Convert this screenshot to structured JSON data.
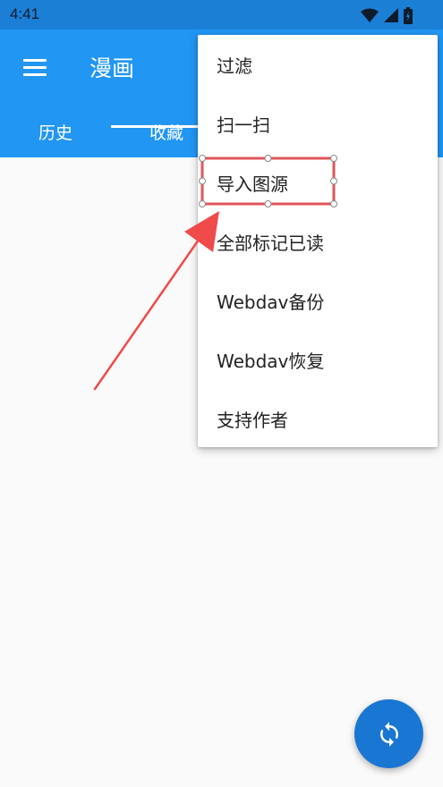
{
  "status_bar": {
    "time": "4:41",
    "icons": [
      "wifi-icon",
      "signal-icon",
      "battery-charging-icon"
    ]
  },
  "app_bar": {
    "menu_icon": "hamburger-menu-icon",
    "title": "漫画",
    "color": "#2196f3"
  },
  "tabs": [
    {
      "label": "历史"
    },
    {
      "label": "收藏"
    }
  ],
  "popup_menu": {
    "items": [
      {
        "label": "过滤"
      },
      {
        "label": "扫一扫"
      },
      {
        "label": "导入图源"
      },
      {
        "label": "全部标记已读"
      },
      {
        "label": "Webdav备份"
      },
      {
        "label": "Webdav恢复"
      },
      {
        "label": "支持作者"
      }
    ]
  },
  "fab": {
    "icon": "sync-icon",
    "color": "#1976d2"
  },
  "annotation": {
    "highlight_color": "#e0565b",
    "arrow_color": "#f04a4a"
  }
}
